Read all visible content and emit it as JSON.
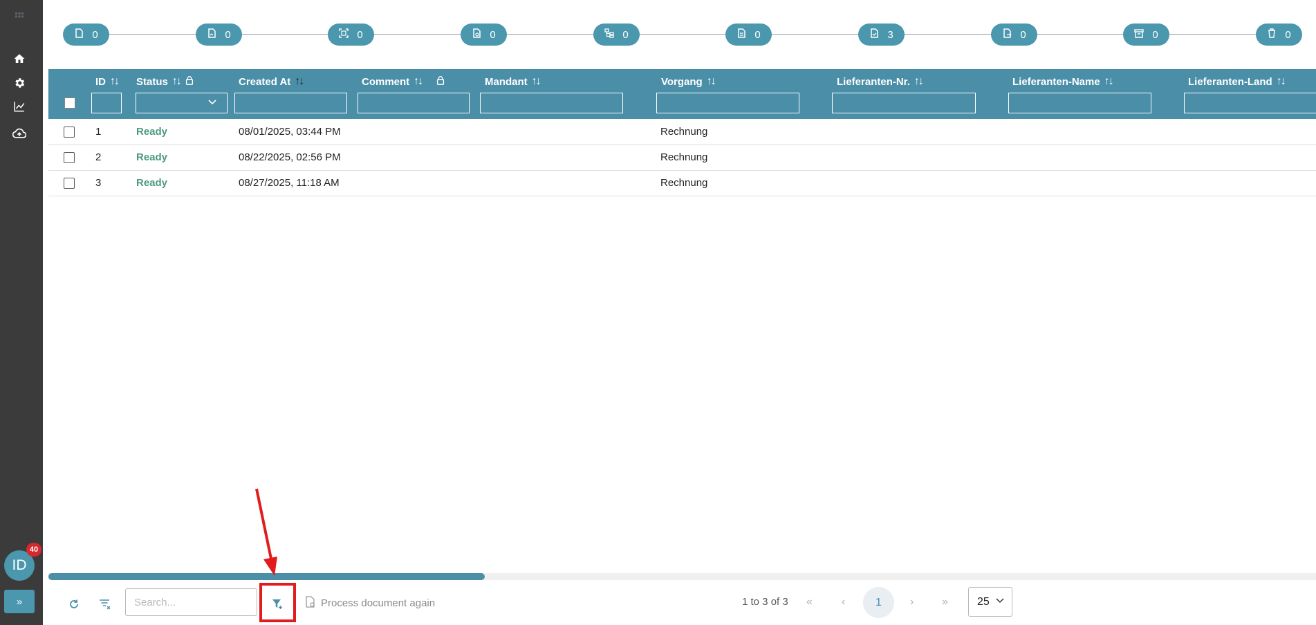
{
  "sidebar": {
    "icons": [
      "grid-icon",
      "home-icon",
      "gear-icon",
      "chart-icon",
      "cloud-upload-icon"
    ],
    "avatar_initials": "ID",
    "notification_count": "40",
    "expand_label": "»"
  },
  "workflow": {
    "steps": [
      {
        "icon": "document-icon",
        "count": "0"
      },
      {
        "icon": "image-document-icon",
        "count": "0"
      },
      {
        "icon": "scan-icon",
        "count": "0"
      },
      {
        "icon": "document-search-icon",
        "count": "0"
      },
      {
        "icon": "hierarchy-icon",
        "count": "0"
      },
      {
        "icon": "document-text-icon",
        "count": "0"
      },
      {
        "icon": "document-check-icon",
        "count": "3"
      },
      {
        "icon": "document-export-icon",
        "count": "0"
      },
      {
        "icon": "archive-icon",
        "count": "0"
      },
      {
        "icon": "trash-icon",
        "count": "0"
      }
    ]
  },
  "table": {
    "columns": [
      "ID",
      "Status",
      "Created At",
      "Comment",
      "Mandant",
      "Vorgang",
      "Lieferanten-Nr.",
      "Lieferanten-Name",
      "Lieferanten-Land"
    ],
    "rows": [
      {
        "id": "1",
        "status": "Ready",
        "created_at": "08/01/2025, 03:44 PM",
        "vorgang": "Rechnung"
      },
      {
        "id": "2",
        "status": "Ready",
        "created_at": "08/22/2025, 02:56 PM",
        "vorgang": "Rechnung"
      },
      {
        "id": "3",
        "status": "Ready",
        "created_at": "08/27/2025, 11:18 AM",
        "vorgang": "Rechnung"
      }
    ]
  },
  "footer": {
    "search_placeholder": "Search...",
    "process_label": "Process document again",
    "page_info": "1 to 3 of 3",
    "current_page": "1",
    "page_size": "25"
  },
  "colors": {
    "accent": "#4a8ea8",
    "step": "#4a97ae",
    "sidebar": "#3b3b3b",
    "ready": "#4c9a7d",
    "highlight": "#e21b1b"
  }
}
